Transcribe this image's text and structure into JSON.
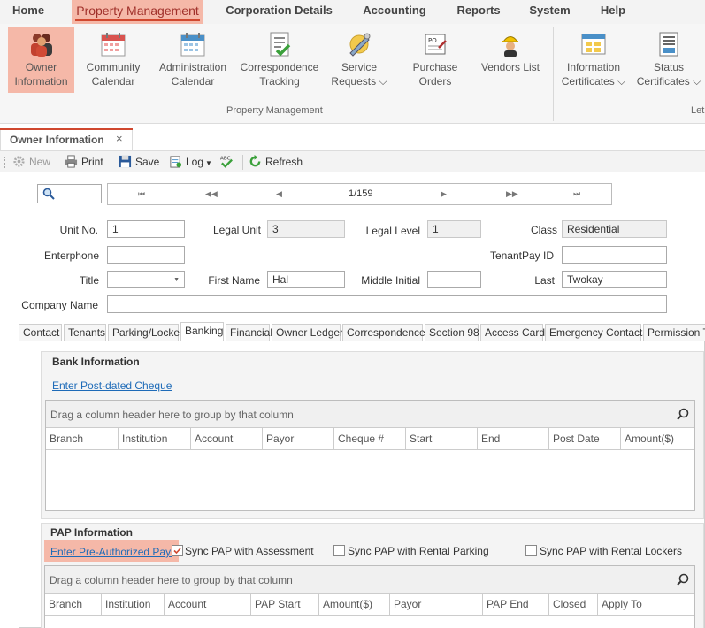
{
  "menu": [
    "Home",
    "Property Management",
    "Corporation Details",
    "Accounting",
    "Reports",
    "System",
    "Help"
  ],
  "ribbon": {
    "buttons": [
      {
        "l1": "Owner",
        "l2": "Information",
        "icon": "owner-information-icon"
      },
      {
        "l1": "Community",
        "l2": "Calendar",
        "icon": "calendar-icon"
      },
      {
        "l1": "Administration",
        "l2": "Calendar",
        "icon": "calendar-icon"
      },
      {
        "l1": "Correspondence",
        "l2": "Tracking",
        "icon": "checklist-icon"
      },
      {
        "l1": "Service",
        "l2": "Requests ⌵",
        "icon": "service-request-icon"
      },
      {
        "l1": "Purchase",
        "l2": "Orders",
        "icon": "purchase-order-icon"
      },
      {
        "l1": "Vendors List",
        "l2": "",
        "icon": "vendor-worker-icon"
      },
      {
        "l1": "Information",
        "l2": "Certificates ⌵",
        "icon": "certificate-icon"
      },
      {
        "l1": "Status",
        "l2": "Certificates ⌵",
        "icon": "status-certificate-icon"
      }
    ],
    "group_label": "Property Management",
    "group_label_cut": "Let"
  },
  "doc_tab": {
    "title": "Owner Information",
    "close": "×"
  },
  "toolbar": {
    "new": "New",
    "print": "Print",
    "save": "Save",
    "log": "Log",
    "refresh": "Refresh"
  },
  "navigator": {
    "position": "1/159",
    "first": "⏮",
    "prev_page": "◀◀",
    "prev": "◀",
    "next": "▶",
    "next_page": "▶▶",
    "last": "⏭"
  },
  "form": {
    "unit_no_label": "Unit No.",
    "unit_no": "1",
    "legal_unit_label": "Legal Unit",
    "legal_unit": "3",
    "legal_level_label": "Legal Level",
    "legal_level": "1",
    "class_label": "Class",
    "class": "Residential",
    "enterphone_label": "Enterphone",
    "enterphone": "",
    "tenantpay_label": "TenantPay ID",
    "tenantpay": "",
    "title_label": "Title",
    "title": "",
    "first_name_label": "First Name",
    "first_name": "Hal",
    "middle_initial_label": "Middle Initial",
    "middle_initial": "",
    "last_label": "Last",
    "last": "Twokay",
    "company_label": "Company Name",
    "company": ""
  },
  "tabs": [
    "Contact",
    "Tenants",
    "Parking/Locker",
    "Banking",
    "Financial",
    "Owner Ledger",
    "Correspondence",
    "Section 98",
    "Access Cards",
    "Emergency Contacts",
    "Permission To"
  ],
  "bank": {
    "header": "Bank Information",
    "link": "Enter Post-dated Cheque",
    "group_hint": "Drag a column header here to group by that column",
    "columns": [
      "Branch",
      "Institution",
      "Account",
      "Payor",
      "Cheque #",
      "Start",
      "End",
      "Post Date",
      "Amount($)"
    ]
  },
  "pap": {
    "header": "PAP Information",
    "link": "Enter Pre-Authorized Payme",
    "sync_assessment": "Sync PAP with Assessment",
    "sync_parking": "Sync PAP with Rental Parking",
    "sync_lockers": "Sync PAP with Rental Lockers",
    "group_hint": "Drag a column header here to group by that column",
    "columns": [
      "Branch",
      "Institution",
      "Account",
      "PAP Start",
      "Amount($)",
      "Payor",
      "PAP End",
      "Closed",
      "Apply To"
    ]
  },
  "colors": {
    "accent": "#d0482f",
    "active_bg": "#f5b8a8",
    "link": "#1e6bb8"
  }
}
